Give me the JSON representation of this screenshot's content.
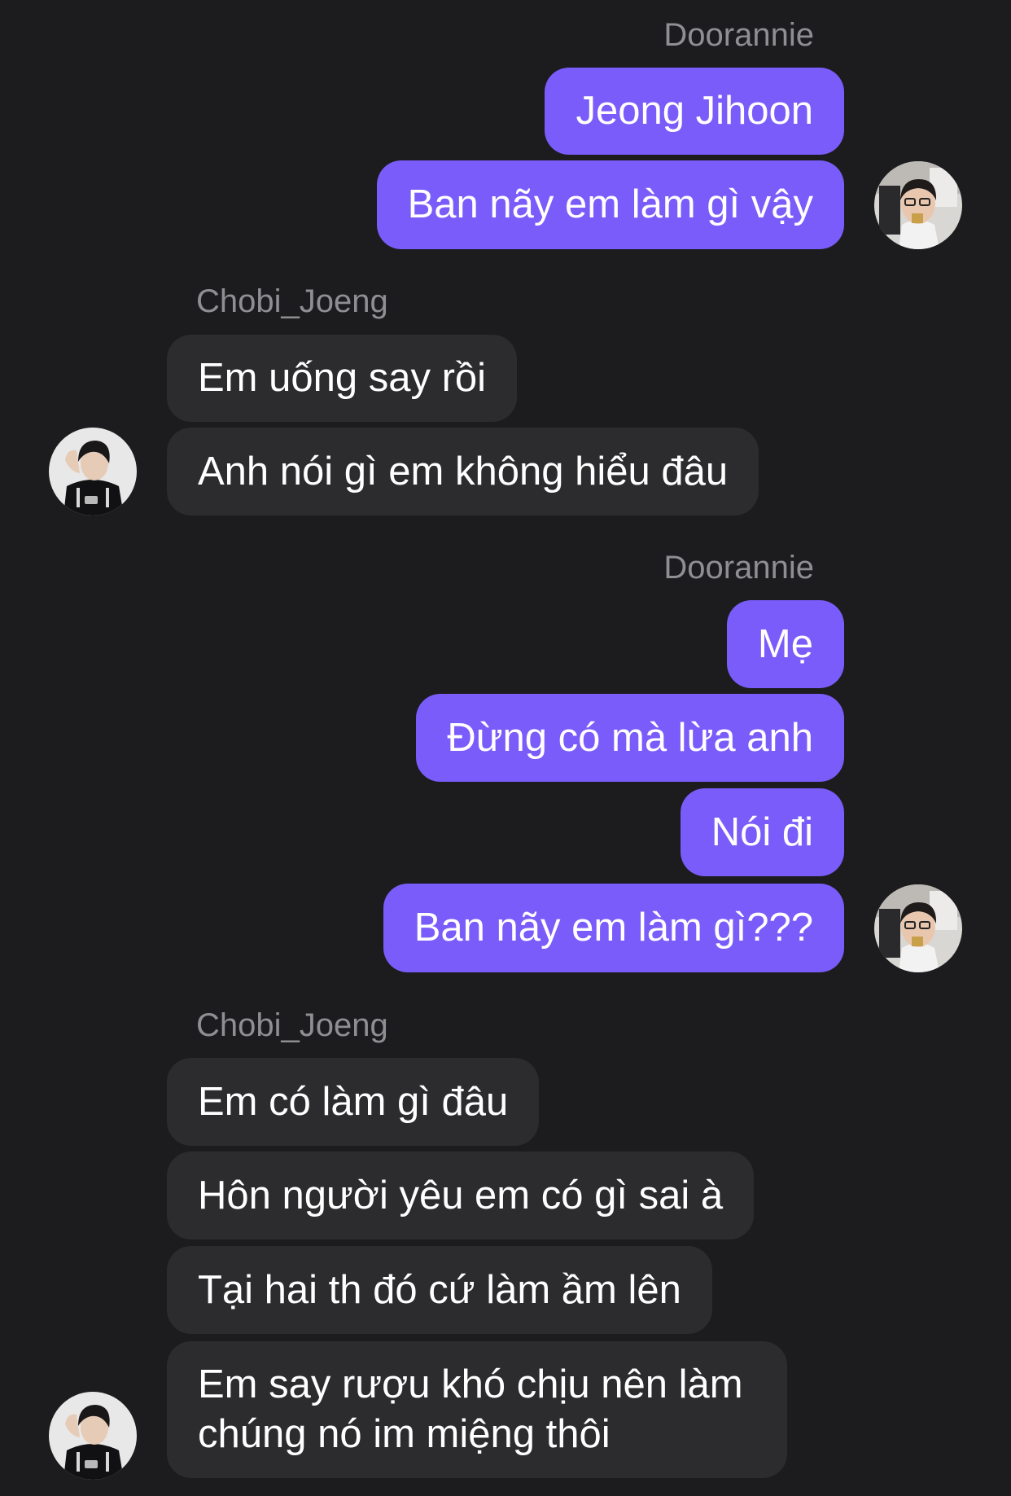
{
  "groups": [
    {
      "sender": "Doorannie",
      "side": "right",
      "messages": [
        "Jeong Jihoon",
        "Ban nãy em làm gì vậy"
      ]
    },
    {
      "sender": "Chobi_Joeng",
      "side": "left",
      "messages": [
        "Em uống say rồi",
        "Anh nói gì em không hiểu đâu"
      ]
    },
    {
      "sender": "Doorannie",
      "side": "right",
      "messages": [
        "Mẹ",
        "Đừng có mà lừa anh",
        "Nói đi",
        "Ban nãy em làm gì???"
      ]
    },
    {
      "sender": "Chobi_Joeng",
      "side": "left",
      "messages": [
        "Em có làm gì đâu",
        "Hôn người yêu em có gì sai à",
        "Tại hai th đó cứ làm ầm lên",
        "Em say rượu khó chịu nên làm chúng nó im miệng thôi"
      ]
    }
  ],
  "colors": {
    "background": "#1c1c1e",
    "outgoing_bubble": "#7a5cfa",
    "incoming_bubble": "#2c2c2e",
    "sender_label": "#8e8e93",
    "message_text": "#ffffff"
  },
  "icons": {
    "outgoing_avatar": "user-avatar-photo",
    "incoming_avatar": "user-avatar-photo"
  }
}
